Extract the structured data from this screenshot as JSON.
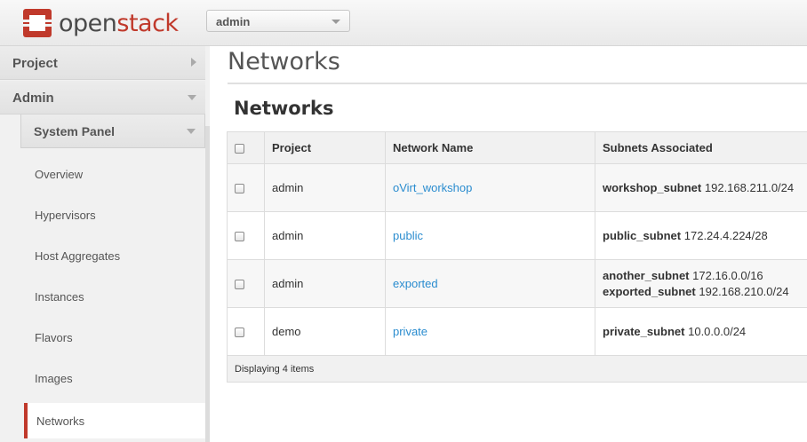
{
  "header": {
    "logo_text_1": "open",
    "logo_text_2": "stack",
    "project_select_value": "admin"
  },
  "sidebar": {
    "project_label": "Project",
    "admin_label": "Admin",
    "panel_label": "System Panel",
    "items": [
      {
        "label": "Overview"
      },
      {
        "label": "Hypervisors"
      },
      {
        "label": "Host Aggregates"
      },
      {
        "label": "Instances"
      },
      {
        "label": "Flavors"
      },
      {
        "label": "Images"
      },
      {
        "label": "Networks"
      }
    ]
  },
  "main": {
    "page_title": "Networks",
    "section_title": "Networks",
    "columns": [
      "Project",
      "Network Name",
      "Subnets Associated"
    ],
    "rows": [
      {
        "project": "admin",
        "network": "oVirt_workshop",
        "subnets": [
          {
            "name": "workshop_subnet",
            "cidr": "192.168.211.0/24"
          }
        ]
      },
      {
        "project": "admin",
        "network": "public",
        "subnets": [
          {
            "name": "public_subnet",
            "cidr": "172.24.4.224/28"
          }
        ]
      },
      {
        "project": "admin",
        "network": "exported",
        "subnets": [
          {
            "name": "another_subnet",
            "cidr": "172.16.0.0/16"
          },
          {
            "name": "exported_subnet",
            "cidr": "192.168.210.0/24"
          }
        ]
      },
      {
        "project": "demo",
        "network": "private",
        "subnets": [
          {
            "name": "private_subnet",
            "cidr": "10.0.0.0/24"
          }
        ]
      }
    ],
    "footer_text": "Displaying 4 items"
  },
  "colors": {
    "brand_red": "#c0392b",
    "link_blue": "#2a8ccf"
  }
}
